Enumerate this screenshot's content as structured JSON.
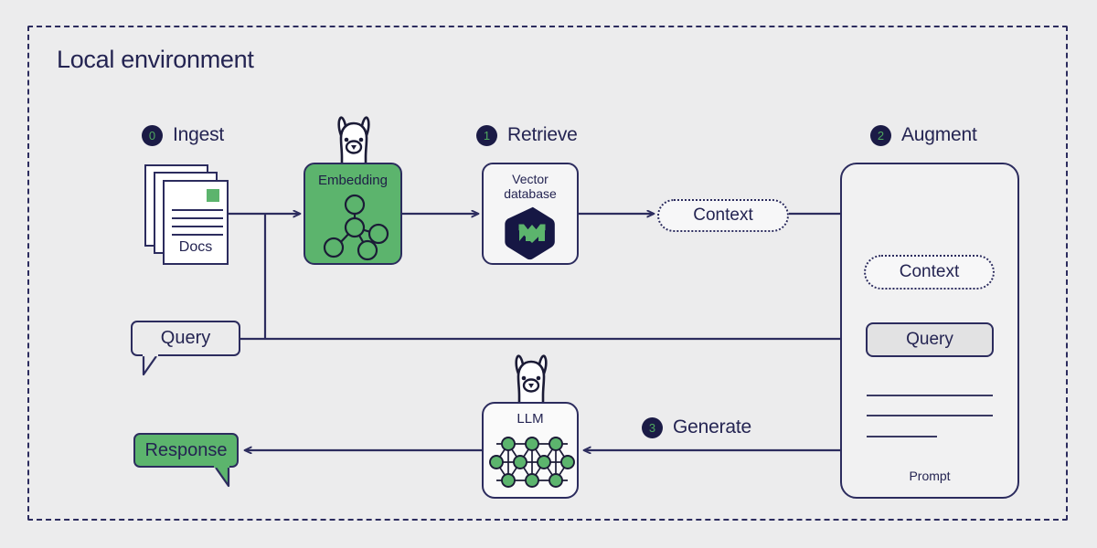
{
  "diagram": {
    "title": "Local environment",
    "frame_style": "dashed",
    "background_color": "#ececed",
    "accent_green": "#5cb46d",
    "accent_navy": "#242452"
  },
  "steps": [
    {
      "number": "0",
      "label": "Ingest"
    },
    {
      "number": "1",
      "label": "Retrieve"
    },
    {
      "number": "2",
      "label": "Augment"
    },
    {
      "number": "3",
      "label": "Generate"
    }
  ],
  "nodes": {
    "docs": {
      "caption": "Docs",
      "icon": "document-stack-icon"
    },
    "embedding": {
      "caption": "Embedding",
      "icon": "node-graph-icon",
      "mascot": "llama-icon",
      "color": "#5cb46d"
    },
    "vector_database": {
      "caption": "Vector\ndatabase",
      "caption_line1": "Vector",
      "caption_line2": "database",
      "icon": "weaviate-logo-icon"
    },
    "context_outer": {
      "label": "Context"
    },
    "context_inner": {
      "label": "Context"
    },
    "query_bubble": {
      "label": "Query"
    },
    "query_inner": {
      "label": "Query"
    },
    "prompt": {
      "caption": "Prompt",
      "line_count": "3"
    },
    "llm": {
      "caption": "LLM",
      "icon": "neural-network-icon",
      "mascot": "llama-icon"
    },
    "response_bubble": {
      "label": "Response",
      "color": "#5cb46d"
    }
  },
  "flow_edges": [
    {
      "from": "docs",
      "to": "embedding"
    },
    {
      "from": "embedding",
      "to": "vector_database"
    },
    {
      "from": "vector_database",
      "to": "context_outer"
    },
    {
      "from": "context_outer",
      "to": "context_inner"
    },
    {
      "from": "query_bubble",
      "to": "embedding"
    },
    {
      "from": "query_bubble",
      "to": "query_inner"
    },
    {
      "from": "prompt",
      "to": "llm"
    },
    {
      "from": "llm",
      "to": "response_bubble"
    }
  ]
}
